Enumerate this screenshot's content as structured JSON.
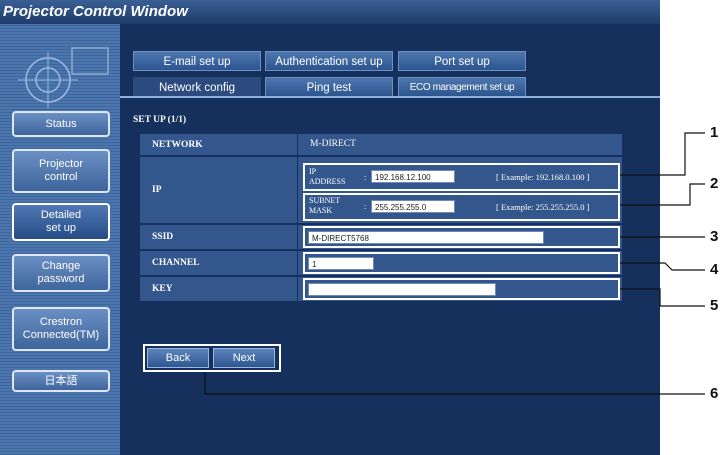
{
  "window": {
    "title": "Projector Control Window"
  },
  "sidebar": {
    "items": [
      {
        "label": "Status"
      },
      {
        "label": "Projector\ncontrol"
      },
      {
        "label": "Detailed\nset up"
      },
      {
        "label": "Change\npassword"
      },
      {
        "label": "Crestron\nConnected(TM)"
      },
      {
        "label": "日本語"
      }
    ]
  },
  "tabs": {
    "row1": [
      "E-mail set up",
      "Authentication set up",
      "Port set up"
    ],
    "row2": [
      "Network config",
      "Ping test",
      "ECO management set up"
    ],
    "active": "Network config"
  },
  "form": {
    "setup_heading": "SET UP (1/1)",
    "network_label": "NETWORK",
    "network_value": "M-DIRECT",
    "ip_label": "IP",
    "ip_address_label_1": "IP",
    "ip_address_label_2": "ADDRESS",
    "ip_address_value": "192.168.12.100",
    "ip_address_example": "[ Example: 192.168.0.100 ]",
    "subnet_label_1": "SUBNET",
    "subnet_label_2": "MASK",
    "subnet_value": "255.255.255.0",
    "subnet_example": "[ Example: 255.255.255.0 ]",
    "ssid_label": "SSID",
    "ssid_value": "M-DIRECT5768",
    "channel_label": "CHANNEL",
    "channel_value": "1",
    "key_label": "KEY",
    "key_value": ""
  },
  "buttons": {
    "back": "Back",
    "next": "Next"
  },
  "callouts": [
    "1",
    "2",
    "3",
    "4",
    "5",
    "6"
  ],
  "colors": {
    "window_bg": "#15305d",
    "sidebar_bg": "#4b75ad",
    "row_bg": "#33568c",
    "highlight": "#ffffff"
  }
}
